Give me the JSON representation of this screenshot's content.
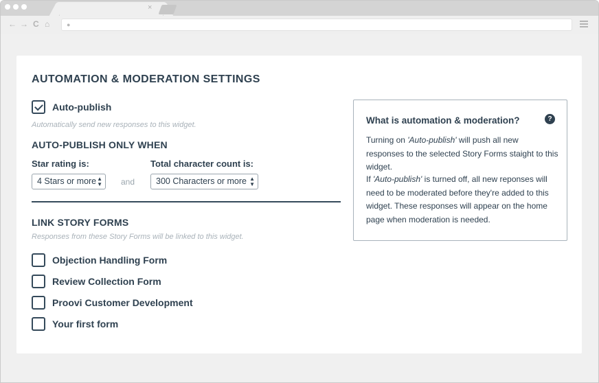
{
  "browser": {
    "tab_close": "×",
    "nav": {
      "back": "←",
      "forward": "→",
      "reload": "C",
      "home": "⌂"
    }
  },
  "settings": {
    "title": "AUTOMATION & MODERATION SETTINGS",
    "auto_publish": {
      "label": "Auto-publish",
      "checked": true,
      "hint": "Automatically send new responses to this widget."
    },
    "only_when": {
      "heading": "AUTO-PUBLISH ONLY WHEN",
      "star_label": "Star rating is:",
      "star_value": "4 Stars or more",
      "joiner": "and",
      "char_label": "Total character count is:",
      "char_value": "300 Characters or more"
    },
    "link_forms": {
      "heading": "LINK STORY FORMS",
      "hint": "Responses from these Story Forms will be linked to this widget.",
      "forms": [
        {
          "label": "Objection Handling Form",
          "checked": false
        },
        {
          "label": "Review Collection Form",
          "checked": false
        },
        {
          "label": "Proovi Customer Development",
          "checked": false
        },
        {
          "label": "Your first form",
          "checked": false
        }
      ]
    }
  },
  "info": {
    "title": "What is automation & moderation?",
    "help": "?",
    "para1_pre": "Turning on ",
    "para1_em": "'Auto-publish'",
    "para1_post": " will push all new responses to the selected Story Forms staight to this widget.",
    "para2_pre": "If ",
    "para2_em": "'Auto-publish'",
    "para2_post": " is turned off, all new reponses will need to be moderated before they're added to this widget. These responses will appear on the home page when moderation is needed."
  }
}
